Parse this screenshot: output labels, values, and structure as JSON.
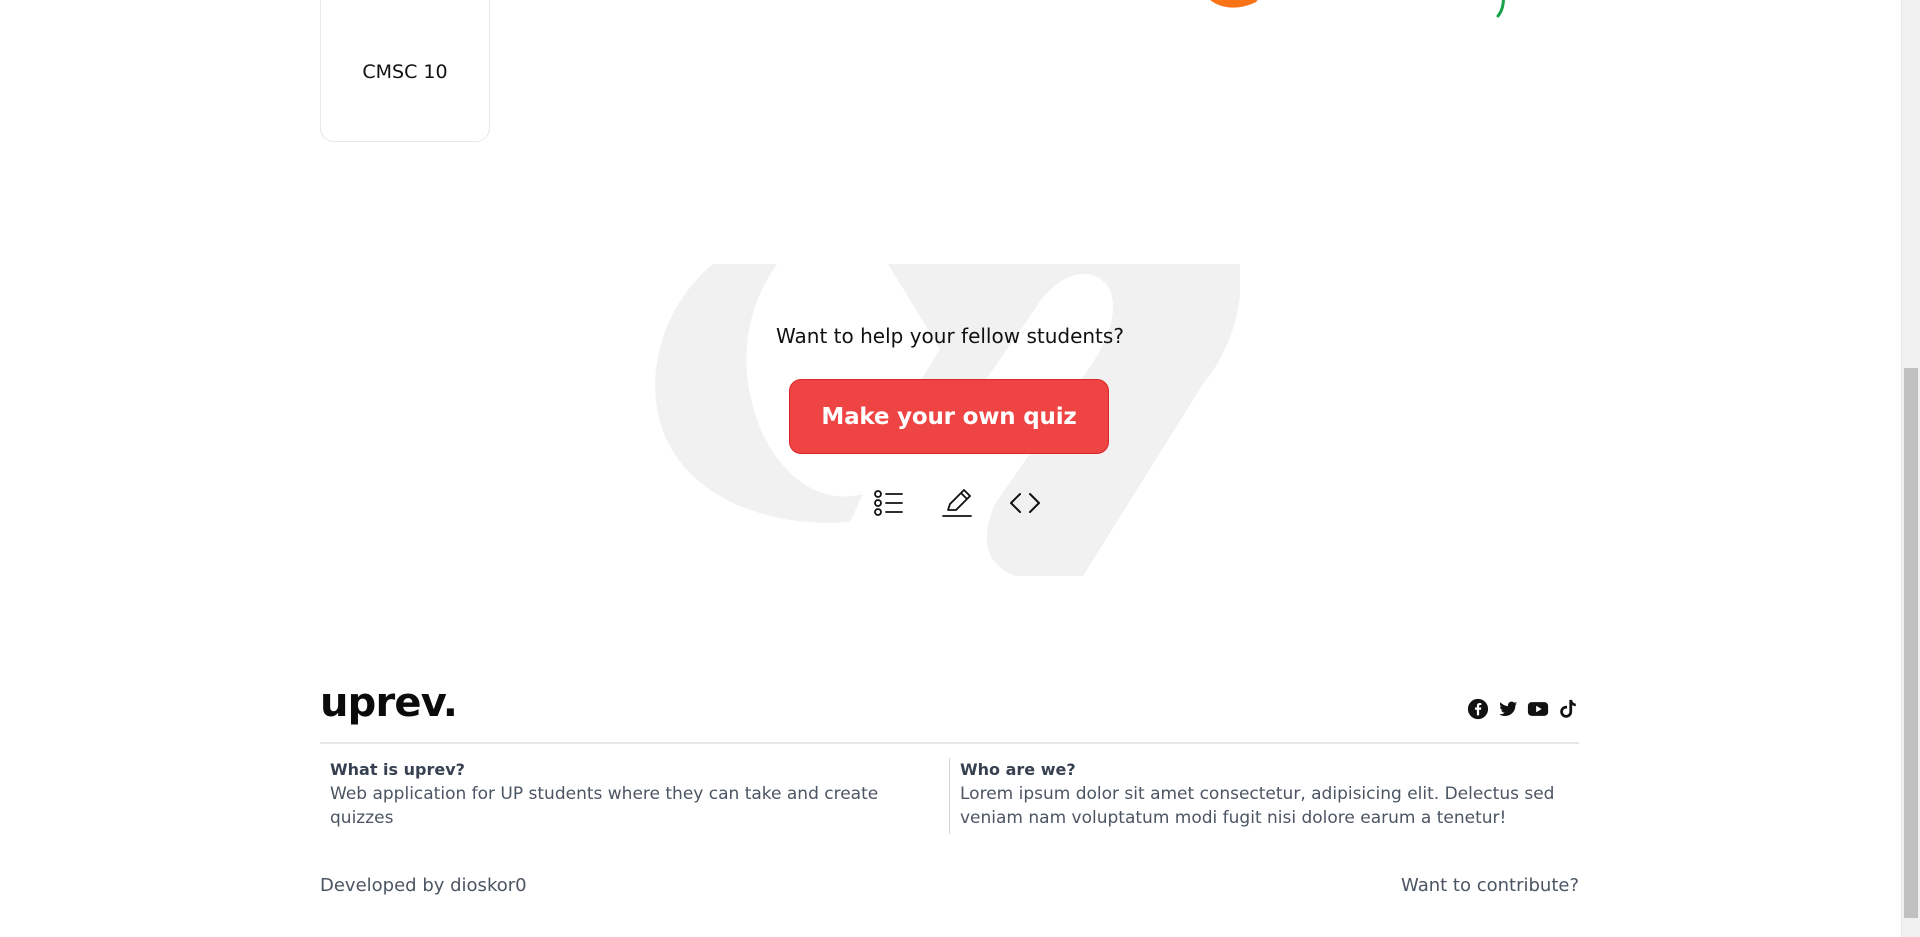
{
  "course_card": {
    "label": "CMSC 10"
  },
  "cta": {
    "prompt": "Want to help your fellow students?",
    "button_label": "Make your own quiz",
    "watermark_color": "#f1f1f1",
    "button_color": "#ef4444",
    "icons": [
      "list-icon",
      "pencil-icon",
      "code-icon"
    ]
  },
  "footer": {
    "logo": "uprev.",
    "socials": [
      "facebook-icon",
      "twitter-icon",
      "youtube-icon",
      "tiktok-icon"
    ],
    "about": {
      "title": "What is uprev?",
      "text": "Web application for UP students where they can take and create quizzes"
    },
    "who": {
      "title": "Who are we?",
      "text": "Lorem ipsum dolor sit amet consectetur, adipisicing elit. Delectus sed veniam nam voluptatum modi fugit nisi dolore earum a tenetur!"
    },
    "developed_by": "Developed by dioskor0",
    "contribute": "Want to contribute?"
  }
}
